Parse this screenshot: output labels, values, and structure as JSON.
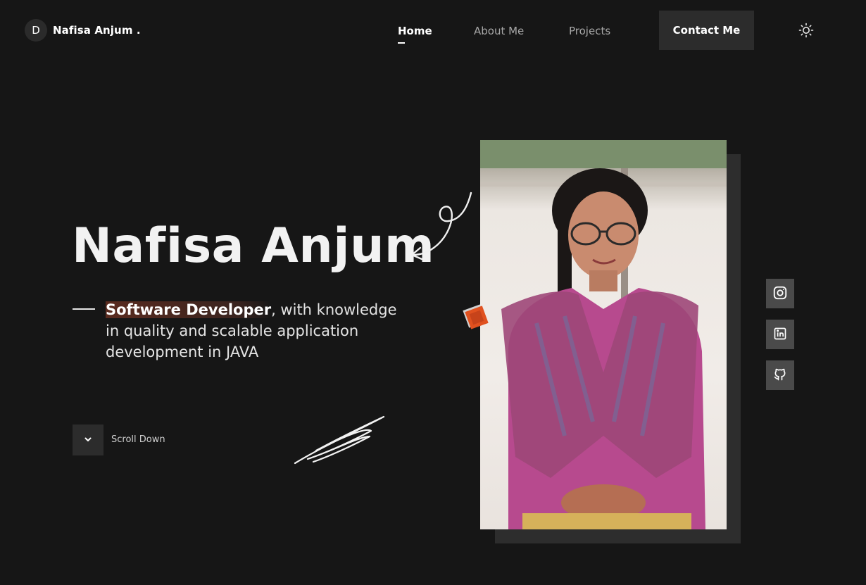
{
  "brand": {
    "logo_letter": "D",
    "name": "Nafisa Anjum ."
  },
  "nav": {
    "links": [
      {
        "label": "Home",
        "active": true
      },
      {
        "label": "About Me",
        "active": false
      },
      {
        "label": "Projects",
        "active": false
      }
    ],
    "contact_label": "Contact Me",
    "theme_icon": "sun-icon"
  },
  "hero": {
    "name": "Nafisa Anjum",
    "role_highlight": "Software Developer",
    "description": ", with knowledge in quality and scalable application development in JAVA",
    "scroll_label": "Scroll Down"
  },
  "social": [
    {
      "icon": "instagram-icon"
    },
    {
      "icon": "linkedin-icon"
    },
    {
      "icon": "github-icon"
    }
  ],
  "colors": {
    "background": "#161616",
    "button_bg": "#2c2c2c",
    "accent": "#e0511f",
    "highlight": "#5a2b1f",
    "social_bg": "#4a4a4a"
  }
}
